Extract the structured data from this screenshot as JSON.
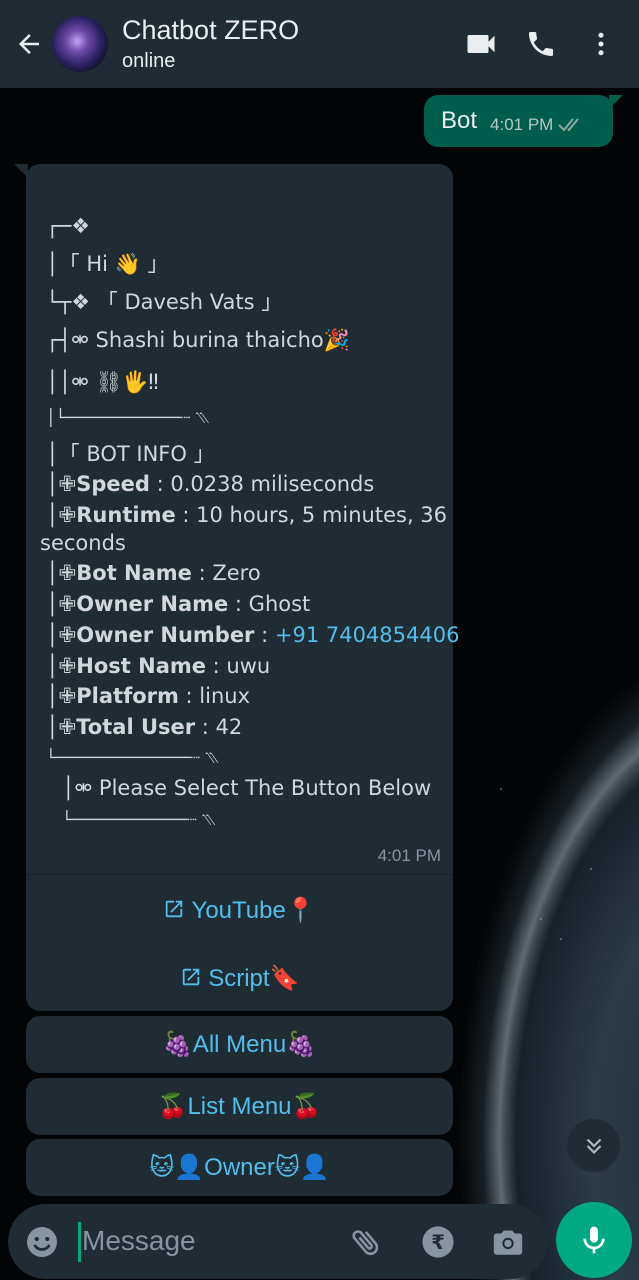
{
  "header": {
    "title": "Chatbot ZERO",
    "status": "online",
    "icons": [
      "back-arrow-icon",
      "video-call-icon",
      "voice-call-icon",
      "more-options-icon"
    ]
  },
  "outgoing": {
    "text": "Bot",
    "time": "4:01 PM"
  },
  "incoming": {
    "lines": {
      "l1": "┌─❖",
      "l2": "│「 Hi 👋 」",
      "l3": "└┬❖ 「 Davesh Vats 」",
      "l4": "┌┤⚮ Shashi burina thaicho🎉",
      "l5": "││⚮ ⛓🖐‼",
      "l6": "│└────────────┈ ⳹",
      "l7": "│「 BOT INFO 」",
      "speed_label": "Speed",
      "speed_value": " : 0.0238 miliseconds",
      "runtime_label": "Runtime",
      "runtime_value": " : 10 hours, 5 minutes, 36",
      "runtime_value2": "seconds",
      "botname_label": "Bot Name",
      "botname_value": " : Zero",
      "ownername_label": "Owner Name",
      "ownername_value": " : Ghost",
      "ownernumber_label": "Owner Number",
      "ownernumber_sep": " : ",
      "ownernumber_value": "+91 7404854406",
      "host_label": "Host Name",
      "host_value": " : uwu",
      "platform_label": "Platform",
      "platform_value": " : linux",
      "total_label": "Total User",
      "total_value": " : 42",
      "l8": "└──────────────┈ ⳹",
      "l9": "│⚮ Please Select The Button Below",
      "l10": "└────────────┈ ⳹",
      "plus": "✙"
    },
    "time": "4:01 PM",
    "buttons": {
      "youtube": "YouTube📍",
      "script": "Script🔖"
    }
  },
  "menu_buttons": {
    "all_menu": "🍇All Menu🍇",
    "list_menu": "🍒List Menu🍒",
    "owner": "🐱👤Owner🐱👤"
  },
  "composer": {
    "placeholder": "Message",
    "icons": [
      "emoji-icon",
      "attach-icon",
      "rupee-payment-icon",
      "camera-icon",
      "mic-icon"
    ]
  },
  "colors": {
    "header_bg": "#1f2c34",
    "outgoing_bg": "#005c4b",
    "incoming_bg": "#1f2c34",
    "link": "#53bdeb",
    "accent": "#00a884"
  }
}
